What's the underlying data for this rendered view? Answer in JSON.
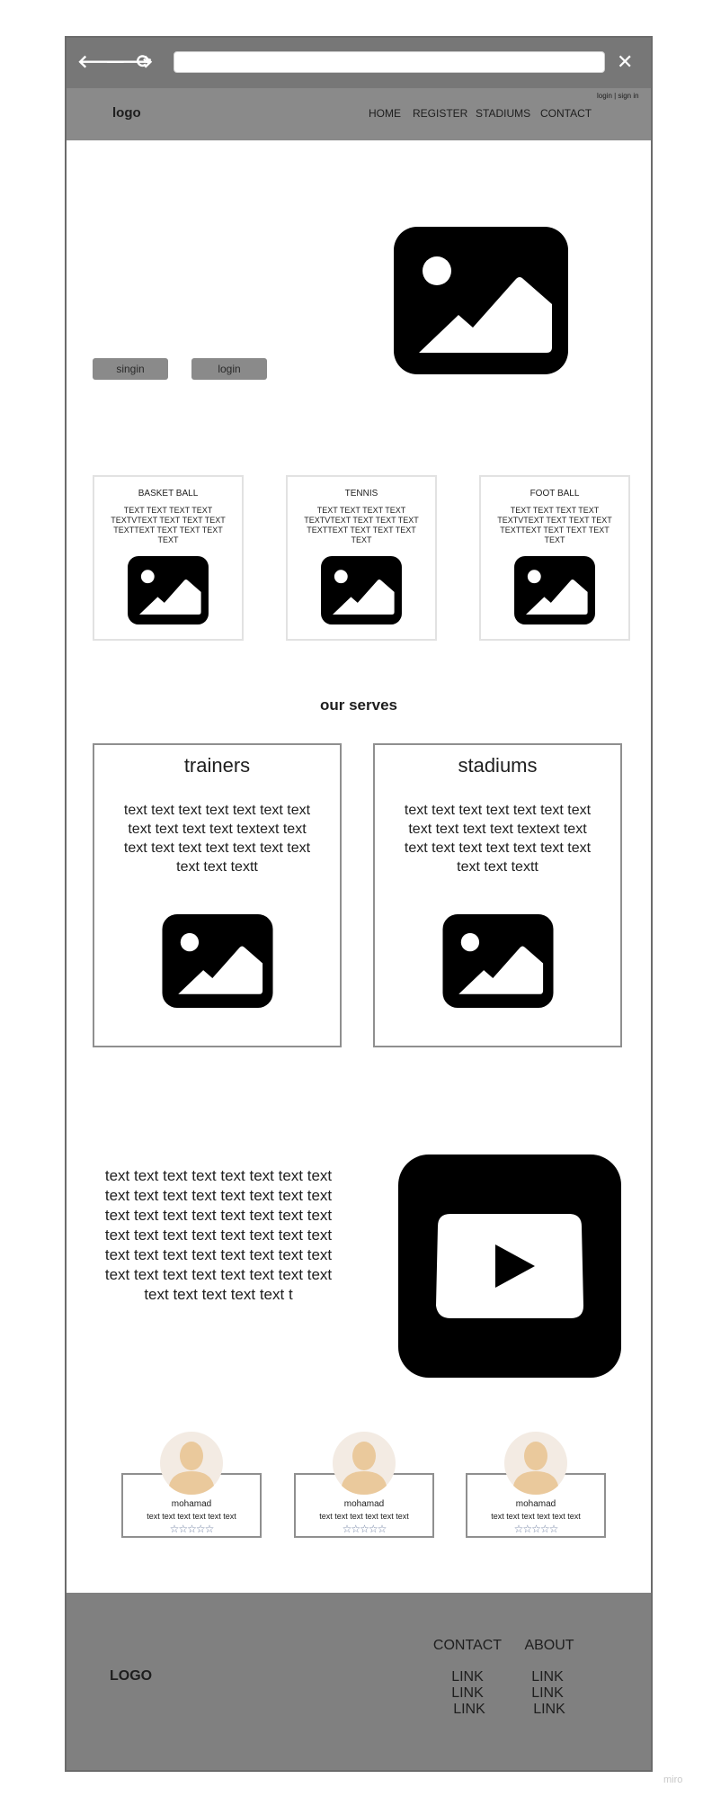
{
  "browser": {
    "back_icon": "arrow-left-icon",
    "forward_icon": "arrow-right-icon",
    "reload_icon": "reload-icon",
    "close_icon": "close-icon",
    "back": "🡐",
    "forward": "🡒",
    "reload": "⟳",
    "close": "✕",
    "url": ""
  },
  "header": {
    "logo": "logo",
    "nav": [
      "HOME",
      "REGISTER",
      "STADIUMS",
      "CONTACT"
    ],
    "login_signin": "login | sign in"
  },
  "hero": {
    "buttons": [
      "singin",
      "login"
    ],
    "image_icon": "image-icon"
  },
  "sports": [
    {
      "title": "BASKET BALL",
      "text": "TEXT TEXT TEXT TEXT TEXTVTEXT TEXT TEXT TEXT TEXTTEXT TEXT TEXT TEXT TEXT"
    },
    {
      "title": "TENNIS",
      "text": "TEXT TEXT TEXT TEXT TEXTVTEXT TEXT TEXT TEXT TEXTTEXT TEXT TEXT TEXT TEXT"
    },
    {
      "title": "FOOT BALL",
      "text": "TEXT TEXT TEXT TEXT TEXTVTEXT TEXT TEXT TEXT TEXTTEXT TEXT TEXT TEXT TEXT"
    }
  ],
  "serves": {
    "title": "our serves",
    "cards": [
      {
        "title": "trainers",
        "text": "text text text text text text text text text text text textext text text text text text text text text text text textt"
      },
      {
        "title": "stadiums",
        "text": "text text text text text text text text text text text textext text text text text text text text text text text textt"
      }
    ]
  },
  "video_section": {
    "text": "text text text text text text text text text text text text text text text text text text text text text text text text text text text text text text text text text text text text text text text text text text text text text text text text text text text text text t",
    "video_icon": "youtube-play-icon"
  },
  "reviews": [
    {
      "name": "mohamad",
      "text": "text text text text text text",
      "stars": "☆☆☆☆☆",
      "rating": 0
    },
    {
      "name": "mohamad",
      "text": "text text text text text text",
      "stars": "☆☆☆☆☆",
      "rating": 0
    },
    {
      "name": "mohamad",
      "text": "text text text text text text",
      "stars": "☆☆☆☆☆",
      "rating": 0
    }
  ],
  "footer": {
    "logo": "LOGO",
    "columns": [
      {
        "heading": "CONTACT",
        "links": [
          "LINK",
          "LINK",
          "LINK"
        ]
      },
      {
        "heading": "ABOUT",
        "links": [
          "LINK",
          "LINK",
          "LINK"
        ]
      }
    ]
  },
  "watermark": "miro",
  "colors": {
    "chrome": "#777777",
    "header": "#8a8a8a",
    "footer": "#808080",
    "buttons": "#8a8a8a",
    "stars": "#6f7fa0"
  }
}
